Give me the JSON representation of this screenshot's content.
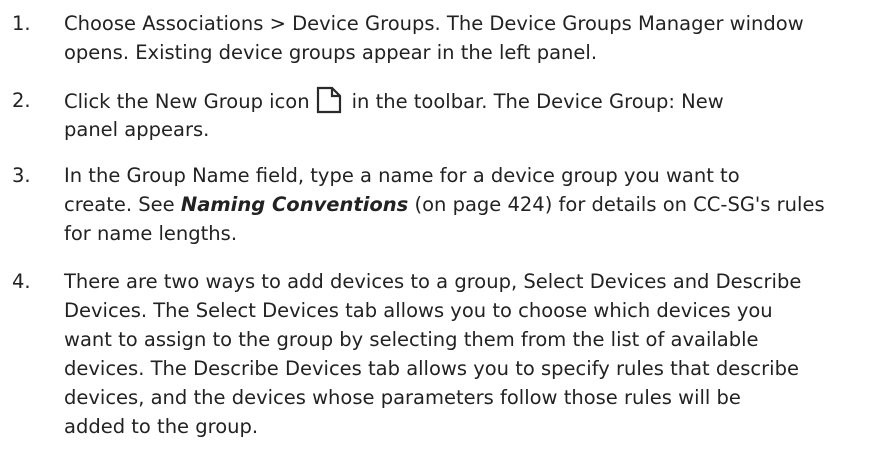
{
  "steps": [
    {
      "number": "1.",
      "line1": "Choose Associations > Device Groups. The Device Groups Manager window",
      "line2": "opens. Existing device groups appear in the left panel."
    },
    {
      "number": "2.",
      "line1_before_icon": "Click the New Group icon",
      "icon": "new-document-icon",
      "line1_after_icon": "in the toolbar. The Device Group: New",
      "line2": "panel appears."
    },
    {
      "number": "3.",
      "line1": "In the Group Name field, type a name for a device group you want to",
      "line2_before": "create. See ",
      "link": "Naming Conventions",
      "line2_after": " (on page 424) for details on CC-SG's rules",
      "line3": "for name lengths."
    },
    {
      "number": "4.",
      "lines": [
        "There are two ways to add devices to a group, Select Devices and Describe",
        "Devices. The Select Devices tab allows you to choose which devices you",
        "want to assign to the group by selecting them from the list of available",
        "devices. The Describe Devices tab allows you to specify rules that describe",
        "devices, and the devices whose parameters follow those rules will be",
        "added to the group."
      ]
    }
  ]
}
